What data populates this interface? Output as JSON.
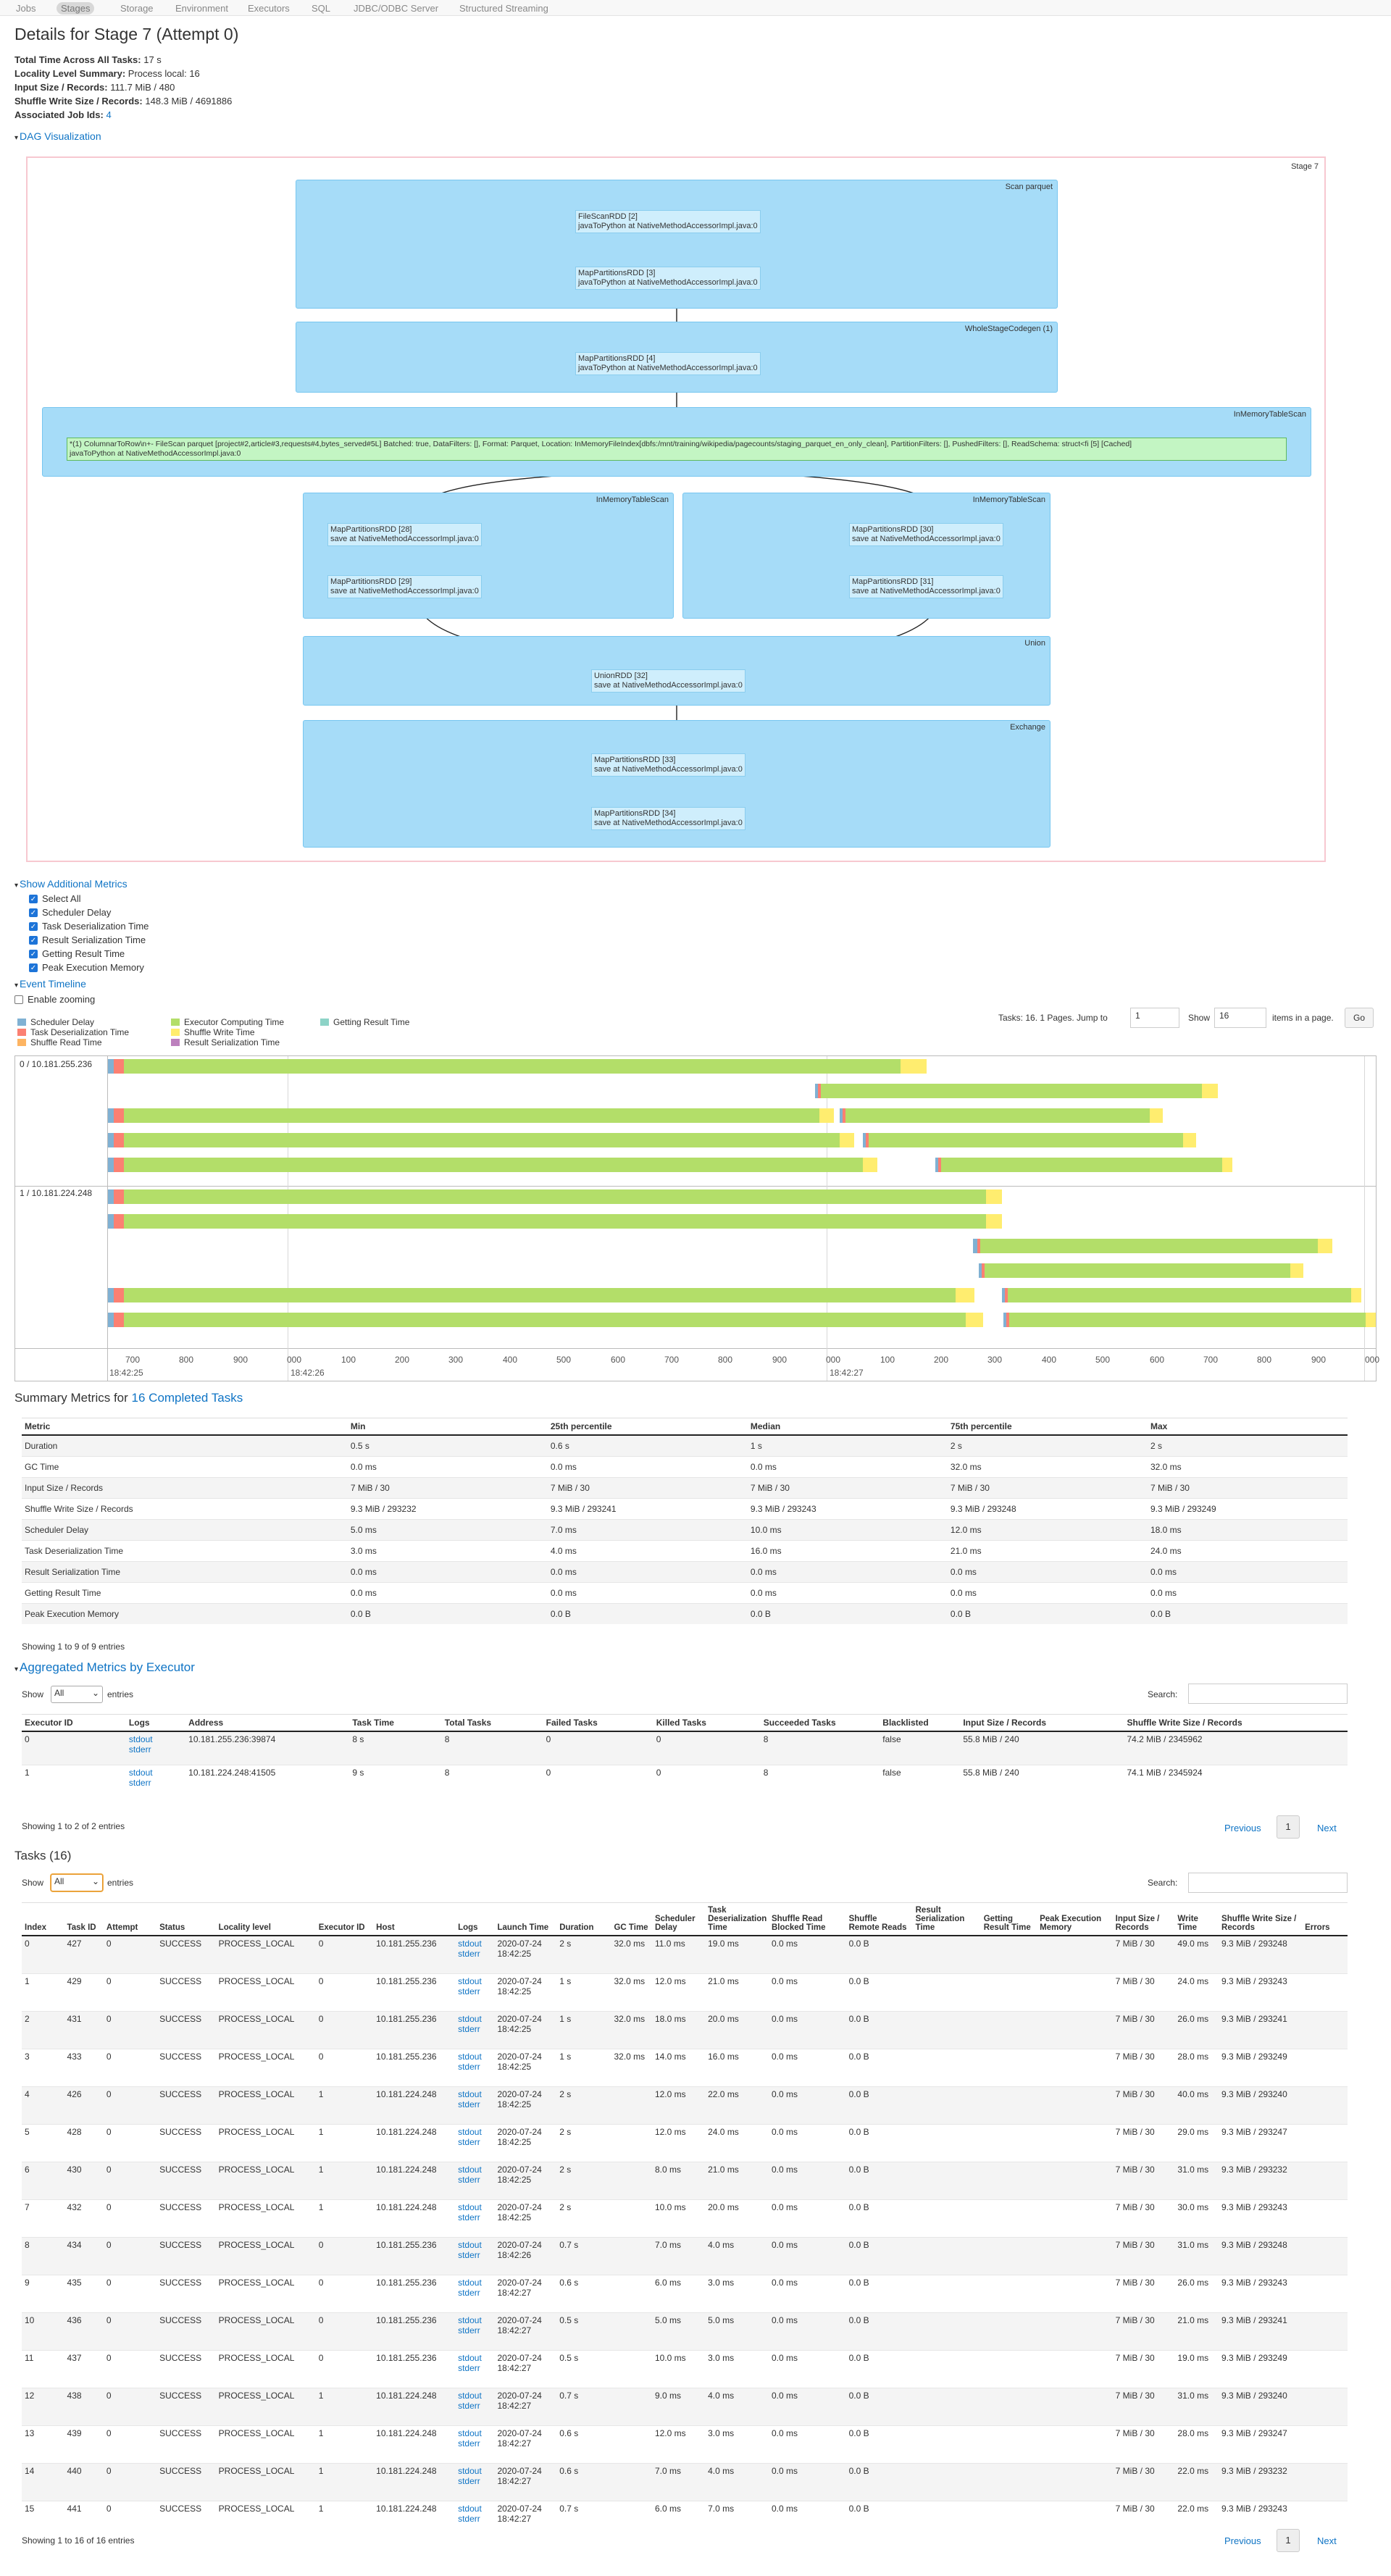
{
  "nav": {
    "items": [
      "Jobs",
      "Stages",
      "Storage",
      "Environment",
      "Executors",
      "SQL",
      "JDBC/ODBC Server",
      "Structured Streaming"
    ],
    "active": "Stages"
  },
  "page_title": "Details for Stage 7 (Attempt 0)",
  "summary": {
    "total_time_label": "Total Time Across All Tasks:",
    "total_time": "17 s",
    "locality_label": "Locality Level Summary:",
    "locality": "Process local: 16",
    "input_label": "Input Size / Records:",
    "input": "111.7 MiB / 480",
    "shuffle_label": "Shuffle Write Size / Records:",
    "shuffle": "148.3 MiB / 4691886",
    "jobs_label": "Associated Job Ids:",
    "jobs": "4"
  },
  "dag": {
    "toggle": "DAG Visualization",
    "stage_label": "Stage 7",
    "clusters": [
      {
        "label": "Scan parquet"
      },
      {
        "label": "WholeStageCodegen (1)"
      },
      {
        "label": "InMemoryTableScan"
      },
      {
        "label": "InMemoryTableScan"
      },
      {
        "label": "InMemoryTableScan"
      },
      {
        "label": "Union"
      },
      {
        "label": "Exchange"
      }
    ],
    "nodes": [
      {
        "l1": "FileScanRDD [2]",
        "l2": "javaToPython at NativeMethodAccessorImpl.java:0"
      },
      {
        "l1": "MapPartitionsRDD [3]",
        "l2": "javaToPython at NativeMethodAccessorImpl.java:0"
      },
      {
        "l1": "MapPartitionsRDD [4]",
        "l2": "javaToPython at NativeMethodAccessorImpl.java:0"
      },
      {
        "l1": "*(1) ColumnarToRow\\n+- FileScan parquet [project#2,article#3,requests#4,bytes_served#5L] Batched: true, DataFilters: [], Format: Parquet, Location: InMemoryFileIndex[dbfs:/mnt/training/wikipedia/pagecounts/staging_parquet_en_only_clean], PartitionFilters: [], PushedFilters: [], ReadSchema: struct<fi [5] [Cached]",
        "l2": "javaToPython at NativeMethodAccessorImpl.java:0"
      },
      {
        "l1": "MapPartitionsRDD [28]",
        "l2": "save at NativeMethodAccessorImpl.java:0"
      },
      {
        "l1": "MapPartitionsRDD [29]",
        "l2": "save at NativeMethodAccessorImpl.java:0"
      },
      {
        "l1": "MapPartitionsRDD [30]",
        "l2": "save at NativeMethodAccessorImpl.java:0"
      },
      {
        "l1": "MapPartitionsRDD [31]",
        "l2": "save at NativeMethodAccessorImpl.java:0"
      },
      {
        "l1": "UnionRDD [32]",
        "l2": "save at NativeMethodAccessorImpl.java:0"
      },
      {
        "l1": "MapPartitionsRDD [33]",
        "l2": "save at NativeMethodAccessorImpl.java:0"
      },
      {
        "l1": "MapPartitionsRDD [34]",
        "l2": "save at NativeMethodAccessorImpl.java:0"
      }
    ]
  },
  "metrics": {
    "toggle": "Show Additional Metrics",
    "items": [
      "Select All",
      "Scheduler Delay",
      "Task Deserialization Time",
      "Result Serialization Time",
      "Getting Result Time",
      "Peak Execution Memory"
    ]
  },
  "timeline": {
    "toggle": "Event Timeline",
    "zoom_label": "Enable zooming",
    "legend": [
      {
        "name": "Scheduler Delay",
        "color": "#80b1d3"
      },
      {
        "name": "Task Deserialization Time",
        "color": "#fb8072"
      },
      {
        "name": "Shuffle Read Time",
        "color": "#fdb462"
      },
      {
        "name": "Executor Computing Time",
        "color": "#b3de69"
      },
      {
        "name": "Shuffle Write Time",
        "color": "#ffed6f"
      },
      {
        "name": "Result Serialization Time",
        "color": "#bc80bd"
      },
      {
        "name": "Getting Result Time",
        "color": "#8dd3c7"
      }
    ],
    "tasks_info": "Tasks: 16. 1 Pages. Jump to",
    "jump_value": "1",
    "show_label": "Show",
    "show_value": "16",
    "items_label": "items in a page.",
    "go": "Go",
    "executors": [
      "0 / 10.181.255.236",
      "1 / 10.181.224.248"
    ],
    "ticks": [
      "700",
      "800",
      "900",
      "000",
      "100",
      "200",
      "300",
      "400",
      "500",
      "600",
      "700",
      "800",
      "900",
      "000",
      "100",
      "200",
      "300",
      "400",
      "500",
      "600",
      "700",
      "800",
      "900",
      "000"
    ],
    "time_labels": [
      "18:42:25",
      "18:42:26",
      "18:42:27"
    ]
  },
  "summary_metrics": {
    "title_prefix": "Summary Metrics for",
    "title_link": "16 Completed Tasks",
    "headers": [
      "Metric",
      "Min",
      "25th percentile",
      "Median",
      "75th percentile",
      "Max"
    ],
    "rows": [
      [
        "Duration",
        "0.5 s",
        "0.6 s",
        "1 s",
        "2 s",
        "2 s"
      ],
      [
        "GC Time",
        "0.0 ms",
        "0.0 ms",
        "0.0 ms",
        "32.0 ms",
        "32.0 ms"
      ],
      [
        "Input Size / Records",
        "7 MiB / 30",
        "7 MiB / 30",
        "7 MiB / 30",
        "7 MiB / 30",
        "7 MiB / 30"
      ],
      [
        "Shuffle Write Size / Records",
        "9.3 MiB / 293232",
        "9.3 MiB / 293241",
        "9.3 MiB / 293243",
        "9.3 MiB / 293248",
        "9.3 MiB / 293249"
      ],
      [
        "Scheduler Delay",
        "5.0 ms",
        "7.0 ms",
        "10.0 ms",
        "12.0 ms",
        "18.0 ms"
      ],
      [
        "Task Deserialization Time",
        "3.0 ms",
        "4.0 ms",
        "16.0 ms",
        "21.0 ms",
        "24.0 ms"
      ],
      [
        "Result Serialization Time",
        "0.0 ms",
        "0.0 ms",
        "0.0 ms",
        "0.0 ms",
        "0.0 ms"
      ],
      [
        "Getting Result Time",
        "0.0 ms",
        "0.0 ms",
        "0.0 ms",
        "0.0 ms",
        "0.0 ms"
      ],
      [
        "Peak Execution Memory",
        "0.0 B",
        "0.0 B",
        "0.0 B",
        "0.0 B",
        "0.0 B"
      ]
    ],
    "entries": "Showing 1 to 9 of 9 entries"
  },
  "aggregated": {
    "toggle": "Aggregated Metrics by Executor",
    "show": "Show",
    "show_value": "All",
    "entries": "entries",
    "search": "Search:",
    "headers": [
      "Executor ID",
      "Logs",
      "Address",
      "Task Time",
      "Total Tasks",
      "Failed Tasks",
      "Killed Tasks",
      "Succeeded Tasks",
      "Blacklisted",
      "Input Size / Records",
      "Shuffle Write Size / Records"
    ],
    "rows": [
      [
        "0",
        "10.181.255.236:39874",
        "8 s",
        "8",
        "0",
        "0",
        "8",
        "false",
        "55.8 MiB / 240",
        "74.2 MiB / 2345962"
      ],
      [
        "1",
        "10.181.224.248:41505",
        "9 s",
        "8",
        "0",
        "0",
        "8",
        "false",
        "55.8 MiB / 240",
        "74.1 MiB / 2345924"
      ]
    ],
    "stdout": "stdout",
    "stderr": "stderr",
    "footer": "Showing 1 to 2 of 2 entries",
    "prev": "Previous",
    "page": "1",
    "next": "Next"
  },
  "tasks": {
    "title": "Tasks (16)",
    "show": "Show",
    "show_value": "All",
    "entries": "entries",
    "search": "Search:",
    "headers": [
      "Index",
      "Task ID",
      "Attempt",
      "Status",
      "Locality level",
      "Executor ID",
      "Host",
      "Logs",
      "Launch Time",
      "Duration",
      "GC Time",
      "Scheduler Delay",
      "Task Deserialization Time",
      "Shuffle Read Blocked Time",
      "Shuffle Remote Reads",
      "Result Serialization Time",
      "Getting Result Time",
      "Peak Execution Memory",
      "Input Size / Records",
      "Write Time",
      "Shuffle Write Size / Records",
      "Errors"
    ],
    "rows": [
      [
        "0",
        "427",
        "0",
        "SUCCESS",
        "PROCESS_LOCAL",
        "0",
        "10.181.255.236",
        "2020-07-24 18:42:25",
        "2 s",
        "32.0 ms",
        "11.0 ms",
        "19.0 ms",
        "0.0 ms",
        "0.0 B",
        "",
        "",
        "",
        "7 MiB / 30",
        "49.0 ms",
        "9.3 MiB / 293248"
      ],
      [
        "1",
        "429",
        "0",
        "SUCCESS",
        "PROCESS_LOCAL",
        "0",
        "10.181.255.236",
        "2020-07-24 18:42:25",
        "1 s",
        "32.0 ms",
        "12.0 ms",
        "21.0 ms",
        "0.0 ms",
        "0.0 B",
        "",
        "",
        "",
        "7 MiB / 30",
        "24.0 ms",
        "9.3 MiB / 293243"
      ],
      [
        "2",
        "431",
        "0",
        "SUCCESS",
        "PROCESS_LOCAL",
        "0",
        "10.181.255.236",
        "2020-07-24 18:42:25",
        "1 s",
        "32.0 ms",
        "18.0 ms",
        "20.0 ms",
        "0.0 ms",
        "0.0 B",
        "",
        "",
        "",
        "7 MiB / 30",
        "26.0 ms",
        "9.3 MiB / 293241"
      ],
      [
        "3",
        "433",
        "0",
        "SUCCESS",
        "PROCESS_LOCAL",
        "0",
        "10.181.255.236",
        "2020-07-24 18:42:25",
        "1 s",
        "32.0 ms",
        "14.0 ms",
        "16.0 ms",
        "0.0 ms",
        "0.0 B",
        "",
        "",
        "",
        "7 MiB / 30",
        "28.0 ms",
        "9.3 MiB / 293249"
      ],
      [
        "4",
        "426",
        "0",
        "SUCCESS",
        "PROCESS_LOCAL",
        "1",
        "10.181.224.248",
        "2020-07-24 18:42:25",
        "2 s",
        "",
        "12.0 ms",
        "22.0 ms",
        "0.0 ms",
        "0.0 B",
        "",
        "",
        "",
        "7 MiB / 30",
        "40.0 ms",
        "9.3 MiB / 293240"
      ],
      [
        "5",
        "428",
        "0",
        "SUCCESS",
        "PROCESS_LOCAL",
        "1",
        "10.181.224.248",
        "2020-07-24 18:42:25",
        "2 s",
        "",
        "12.0 ms",
        "24.0 ms",
        "0.0 ms",
        "0.0 B",
        "",
        "",
        "",
        "7 MiB / 30",
        "29.0 ms",
        "9.3 MiB / 293247"
      ],
      [
        "6",
        "430",
        "0",
        "SUCCESS",
        "PROCESS_LOCAL",
        "1",
        "10.181.224.248",
        "2020-07-24 18:42:25",
        "2 s",
        "",
        "8.0 ms",
        "21.0 ms",
        "0.0 ms",
        "0.0 B",
        "",
        "",
        "",
        "7 MiB / 30",
        "31.0 ms",
        "9.3 MiB / 293232"
      ],
      [
        "7",
        "432",
        "0",
        "SUCCESS",
        "PROCESS_LOCAL",
        "1",
        "10.181.224.248",
        "2020-07-24 18:42:25",
        "2 s",
        "",
        "10.0 ms",
        "20.0 ms",
        "0.0 ms",
        "0.0 B",
        "",
        "",
        "",
        "7 MiB / 30",
        "30.0 ms",
        "9.3 MiB / 293243"
      ],
      [
        "8",
        "434",
        "0",
        "SUCCESS",
        "PROCESS_LOCAL",
        "0",
        "10.181.255.236",
        "2020-07-24 18:42:26",
        "0.7 s",
        "",
        "7.0 ms",
        "4.0 ms",
        "0.0 ms",
        "0.0 B",
        "",
        "",
        "",
        "7 MiB / 30",
        "31.0 ms",
        "9.3 MiB / 293248"
      ],
      [
        "9",
        "435",
        "0",
        "SUCCESS",
        "PROCESS_LOCAL",
        "0",
        "10.181.255.236",
        "2020-07-24 18:42:27",
        "0.6 s",
        "",
        "6.0 ms",
        "3.0 ms",
        "0.0 ms",
        "0.0 B",
        "",
        "",
        "",
        "7 MiB / 30",
        "26.0 ms",
        "9.3 MiB / 293243"
      ],
      [
        "10",
        "436",
        "0",
        "SUCCESS",
        "PROCESS_LOCAL",
        "0",
        "10.181.255.236",
        "2020-07-24 18:42:27",
        "0.5 s",
        "",
        "5.0 ms",
        "5.0 ms",
        "0.0 ms",
        "0.0 B",
        "",
        "",
        "",
        "7 MiB / 30",
        "21.0 ms",
        "9.3 MiB / 293241"
      ],
      [
        "11",
        "437",
        "0",
        "SUCCESS",
        "PROCESS_LOCAL",
        "0",
        "10.181.255.236",
        "2020-07-24 18:42:27",
        "0.5 s",
        "",
        "10.0 ms",
        "3.0 ms",
        "0.0 ms",
        "0.0 B",
        "",
        "",
        "",
        "7 MiB / 30",
        "19.0 ms",
        "9.3 MiB / 293249"
      ],
      [
        "12",
        "438",
        "0",
        "SUCCESS",
        "PROCESS_LOCAL",
        "1",
        "10.181.224.248",
        "2020-07-24 18:42:27",
        "0.7 s",
        "",
        "9.0 ms",
        "4.0 ms",
        "0.0 ms",
        "0.0 B",
        "",
        "",
        "",
        "7 MiB / 30",
        "31.0 ms",
        "9.3 MiB / 293240"
      ],
      [
        "13",
        "439",
        "0",
        "SUCCESS",
        "PROCESS_LOCAL",
        "1",
        "10.181.224.248",
        "2020-07-24 18:42:27",
        "0.6 s",
        "",
        "12.0 ms",
        "3.0 ms",
        "0.0 ms",
        "0.0 B",
        "",
        "",
        "",
        "7 MiB / 30",
        "28.0 ms",
        "9.3 MiB / 293247"
      ],
      [
        "14",
        "440",
        "0",
        "SUCCESS",
        "PROCESS_LOCAL",
        "1",
        "10.181.224.248",
        "2020-07-24 18:42:27",
        "0.6 s",
        "",
        "7.0 ms",
        "4.0 ms",
        "0.0 ms",
        "0.0 B",
        "",
        "",
        "",
        "7 MiB / 30",
        "22.0 ms",
        "9.3 MiB / 293232"
      ],
      [
        "15",
        "441",
        "0",
        "SUCCESS",
        "PROCESS_LOCAL",
        "1",
        "10.181.224.248",
        "2020-07-24 18:42:27",
        "0.7 s",
        "",
        "6.0 ms",
        "7.0 ms",
        "0.0 ms",
        "0.0 B",
        "",
        "",
        "",
        "7 MiB / 30",
        "22.0 ms",
        "9.3 MiB / 293243"
      ]
    ],
    "stdout": "stdout",
    "stderr": "stderr",
    "footer": "Showing 1 to 16 of 16 entries",
    "prev": "Previous",
    "page": "1",
    "next": "Next"
  }
}
